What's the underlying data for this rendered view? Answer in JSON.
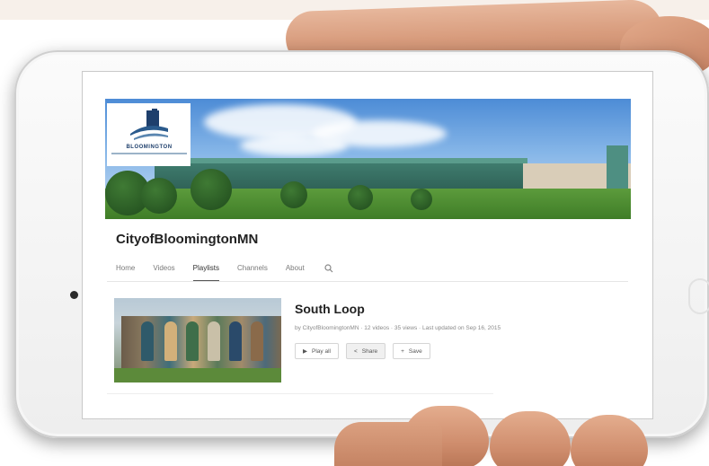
{
  "channel": {
    "name": "CityofBloomingtonMN",
    "logo_text": "BLOOMINGTON"
  },
  "tabs": [
    {
      "label": "Home"
    },
    {
      "label": "Videos"
    },
    {
      "label": "Playlists",
      "active": true
    },
    {
      "label": "Channels"
    },
    {
      "label": "About"
    }
  ],
  "search_icon": "search-icon",
  "playlist": {
    "title": "South Loop",
    "meta": "by CityofBloomingtonMN · 12 videos · 35 views · Last updated on Sep 16, 2015",
    "buttons": {
      "play_all": "Play all",
      "share": "Share",
      "save": "Save"
    }
  },
  "colors": {
    "accent": "#222222",
    "logo_blue": "#1e3f6c"
  }
}
